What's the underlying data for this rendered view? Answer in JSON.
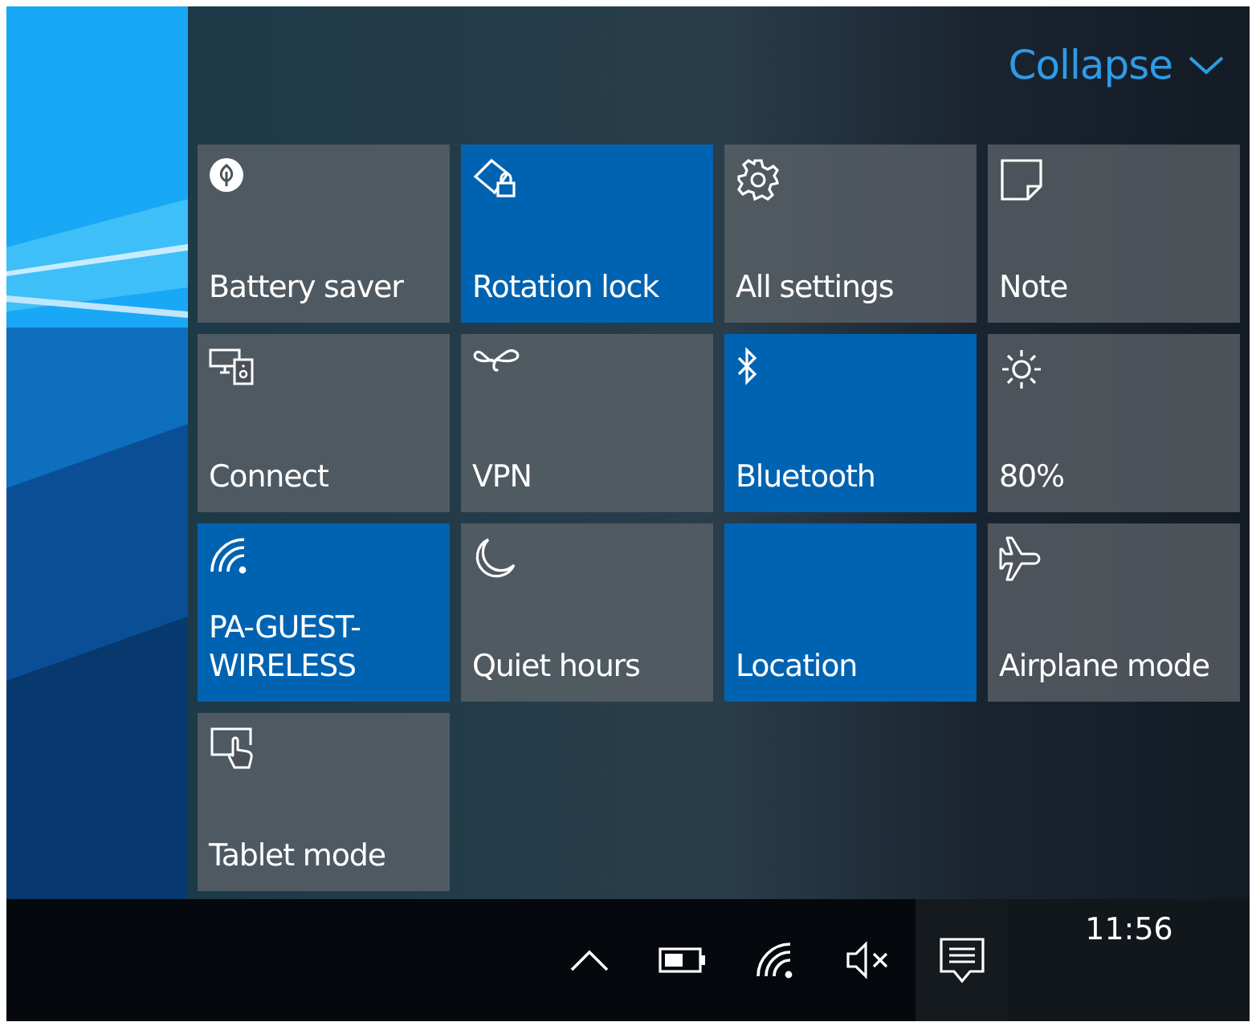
{
  "header": {
    "collapse_label": "Collapse"
  },
  "tiles": [
    {
      "label": "Battery saver",
      "kind": "leaf",
      "selected": false
    },
    {
      "label": "Rotation lock",
      "kind": "rotation",
      "selected": true
    },
    {
      "label": "All settings",
      "kind": "gear",
      "selected": false
    },
    {
      "label": "Note",
      "kind": "note",
      "selected": false
    },
    {
      "label": "Connect",
      "kind": "connect",
      "selected": false
    },
    {
      "label": "VPN",
      "kind": "vpn",
      "selected": false
    },
    {
      "label": "Bluetooth",
      "kind": "bluetooth",
      "selected": true
    },
    {
      "label": "80%",
      "kind": "sun",
      "selected": false
    },
    {
      "label": "PA-GUEST-\nWIRELESS",
      "kind": "wifi",
      "selected": true
    },
    {
      "label": "Quiet hours",
      "kind": "moon",
      "selected": false
    },
    {
      "label": "Location",
      "kind": "location",
      "selected": true
    },
    {
      "label": "Airplane mode",
      "kind": "plane",
      "selected": false
    },
    {
      "label": "Tablet mode",
      "kind": "tablet",
      "selected": false
    }
  ],
  "taskbar": {
    "clock": "11:56"
  }
}
